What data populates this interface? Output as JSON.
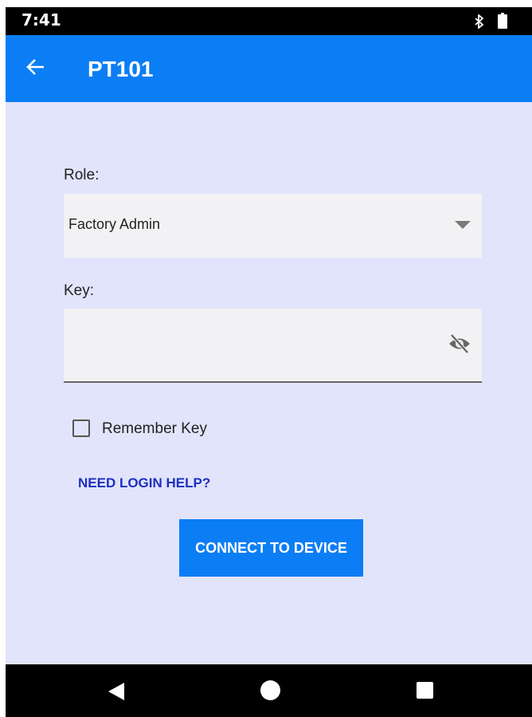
{
  "status_bar": {
    "time": "7:41"
  },
  "app_bar": {
    "title": "PT101"
  },
  "form": {
    "role_label": "Role:",
    "role_value": "Factory Admin",
    "key_label": "Key:",
    "key_value": "",
    "remember_key_label": "Remember Key",
    "remember_key_checked": false,
    "help_link": "NEED LOGIN HELP?",
    "connect_button": "CONNECT TO DEVICE"
  },
  "icons": {
    "back": "arrow-left-icon",
    "dropdown": "chevron-down-icon",
    "visibility": "eye-off-icon",
    "bluetooth": "bluetooth-icon",
    "battery": "battery-icon"
  },
  "colors": {
    "primary": "#0b7ef5",
    "background": "#e2e4fb",
    "link": "#1c2fc0"
  }
}
